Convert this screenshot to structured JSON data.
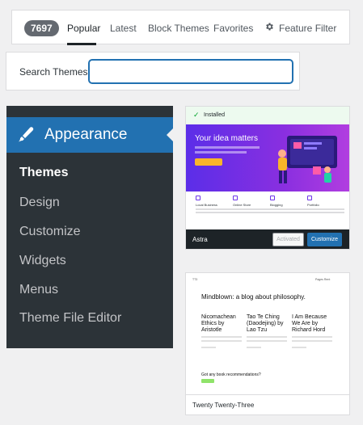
{
  "filter_bar": {
    "count": "7697",
    "tabs": [
      {
        "label": "Popular",
        "active": true
      },
      {
        "label": "Latest",
        "active": false
      },
      {
        "label": "Block Themes",
        "active": false
      },
      {
        "label": "Favorites",
        "active": false
      }
    ],
    "feature_filter": {
      "label": "Feature Filter",
      "icon": "gear-icon"
    }
  },
  "search": {
    "label": "Search Themes",
    "value": "",
    "placeholder": ""
  },
  "admin_menu": {
    "section": {
      "label": "Appearance",
      "icon": "paintbrush-icon"
    },
    "items": [
      {
        "label": "Themes",
        "current": true
      },
      {
        "label": "Design",
        "current": false
      },
      {
        "label": "Customize",
        "current": false
      },
      {
        "label": "Widgets",
        "current": false
      },
      {
        "label": "Menus",
        "current": false
      },
      {
        "label": "Theme File Editor",
        "current": false
      }
    ]
  },
  "themes": [
    {
      "name": "Astra",
      "installed_label": "Installed",
      "preview": {
        "headline": "Your idea matters",
        "features": [
          "Local Business",
          "Online Store",
          "Blogging",
          "Portfolio"
        ]
      },
      "actions": {
        "activated": "Activated",
        "customize": "Customize"
      }
    },
    {
      "name": "Twenty Twenty-Three",
      "preview": {
        "site_title": "TT3",
        "nav_links": "Pages   Rent",
        "headline": "Mindblown: a blog about philosophy.",
        "posts": [
          "Nicomachean Ethics by Aristotle",
          "Tao Te Ching (Daodejing) by Lao Tzu",
          "I Am Because We Are by Richard Hord"
        ],
        "footer_prompt": "Got any book recommendations?"
      }
    }
  ],
  "colors": {
    "admin_blue": "#2271b1",
    "menu_bg": "#2c3338",
    "installed_green": "#00a32a",
    "astra_gradient_start": "#5b2ee8",
    "astra_accent": "#f9b52a"
  }
}
